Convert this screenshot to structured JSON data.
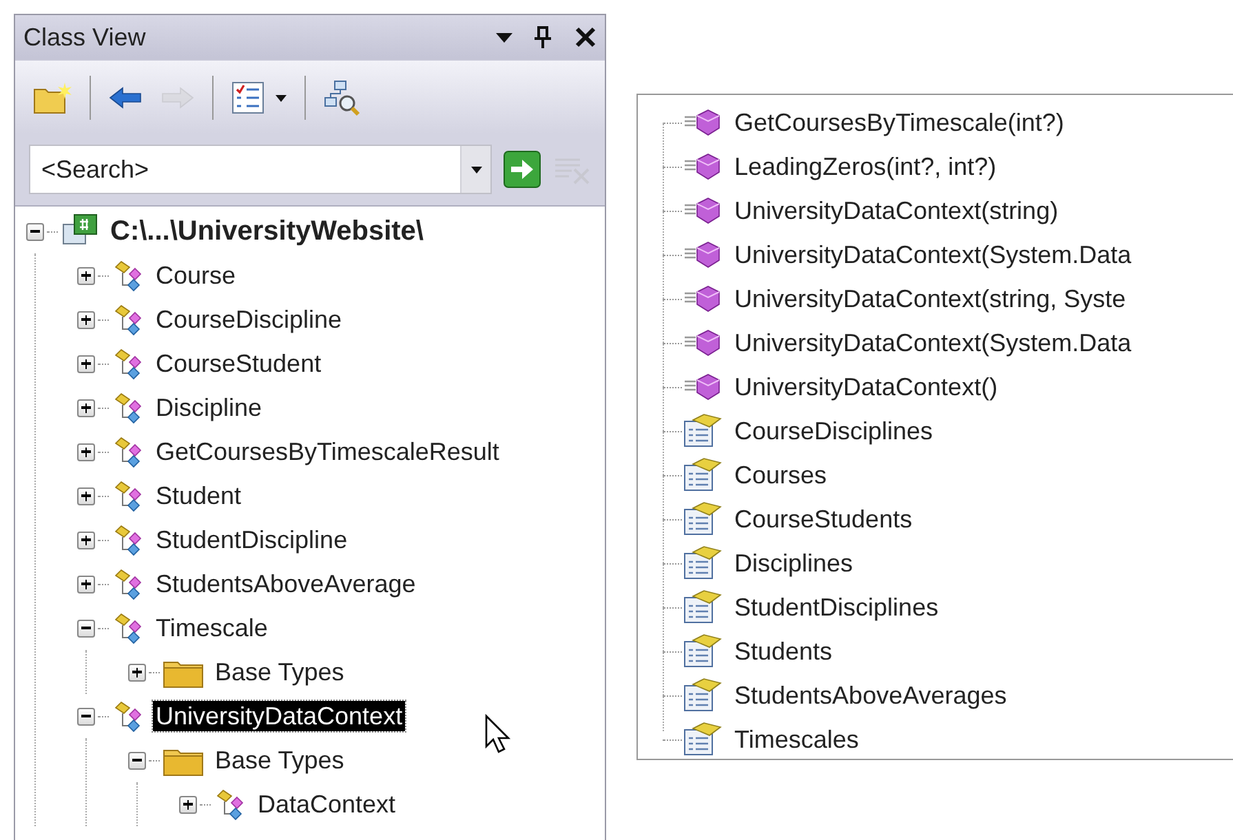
{
  "class_view": {
    "title": "Class View",
    "toolbar": [
      {
        "kind": "new-folder",
        "disabled": false
      },
      {
        "kind": "back",
        "disabled": false
      },
      {
        "kind": "forward",
        "disabled": true
      },
      {
        "kind": "settings",
        "disabled": false
      },
      {
        "kind": "find",
        "disabled": false
      }
    ],
    "search": {
      "placeholder": "<Search>",
      "clear_disabled": true
    },
    "tree": [
      {
        "label": "C:\\...\\UniversityWebsite\\",
        "kind": "project",
        "expanded": true,
        "selected": false,
        "children": [
          {
            "label": "Course",
            "kind": "class",
            "expanded": false,
            "selected": false
          },
          {
            "label": "CourseDiscipline",
            "kind": "class",
            "expanded": false,
            "selected": false
          },
          {
            "label": "CourseStudent",
            "kind": "class",
            "expanded": false,
            "selected": false
          },
          {
            "label": "Discipline",
            "kind": "class",
            "expanded": false,
            "selected": false
          },
          {
            "label": "GetCoursesByTimescaleResult",
            "kind": "class",
            "expanded": false,
            "selected": false
          },
          {
            "label": "Student",
            "kind": "class",
            "expanded": false,
            "selected": false
          },
          {
            "label": "StudentDiscipline",
            "kind": "class",
            "expanded": false,
            "selected": false
          },
          {
            "label": "StudentsAboveAverage",
            "kind": "class",
            "expanded": false,
            "selected": false
          },
          {
            "label": "Timescale",
            "kind": "class",
            "expanded": true,
            "selected": false,
            "children": [
              {
                "label": "Base Types",
                "kind": "folder",
                "expanded": false,
                "selected": false
              }
            ]
          },
          {
            "label": "UniversityDataContext",
            "kind": "class",
            "expanded": true,
            "selected": true,
            "children": [
              {
                "label": "Base Types",
                "kind": "folder",
                "expanded": true,
                "selected": false,
                "children": [
                  {
                    "label": "DataContext",
                    "kind": "class",
                    "expanded": false,
                    "selected": false
                  }
                ]
              }
            ]
          }
        ]
      }
    ]
  },
  "members": [
    {
      "label": "GetCoursesByTimescale(int?)",
      "kind": "method"
    },
    {
      "label": "LeadingZeros(int?, int?)",
      "kind": "method"
    },
    {
      "label": "UniversityDataContext(string)",
      "kind": "method"
    },
    {
      "label": "UniversityDataContext(System.Data",
      "kind": "method"
    },
    {
      "label": "UniversityDataContext(string, Syste",
      "kind": "method"
    },
    {
      "label": "UniversityDataContext(System.Data",
      "kind": "method"
    },
    {
      "label": "UniversityDataContext()",
      "kind": "method"
    },
    {
      "label": "CourseDisciplines",
      "kind": "property"
    },
    {
      "label": "Courses",
      "kind": "property"
    },
    {
      "label": "CourseStudents",
      "kind": "property"
    },
    {
      "label": "Disciplines",
      "kind": "property"
    },
    {
      "label": "StudentDisciplines",
      "kind": "property"
    },
    {
      "label": "Students",
      "kind": "property"
    },
    {
      "label": "StudentsAboveAverages",
      "kind": "property"
    },
    {
      "label": "Timescales",
      "kind": "property"
    }
  ]
}
